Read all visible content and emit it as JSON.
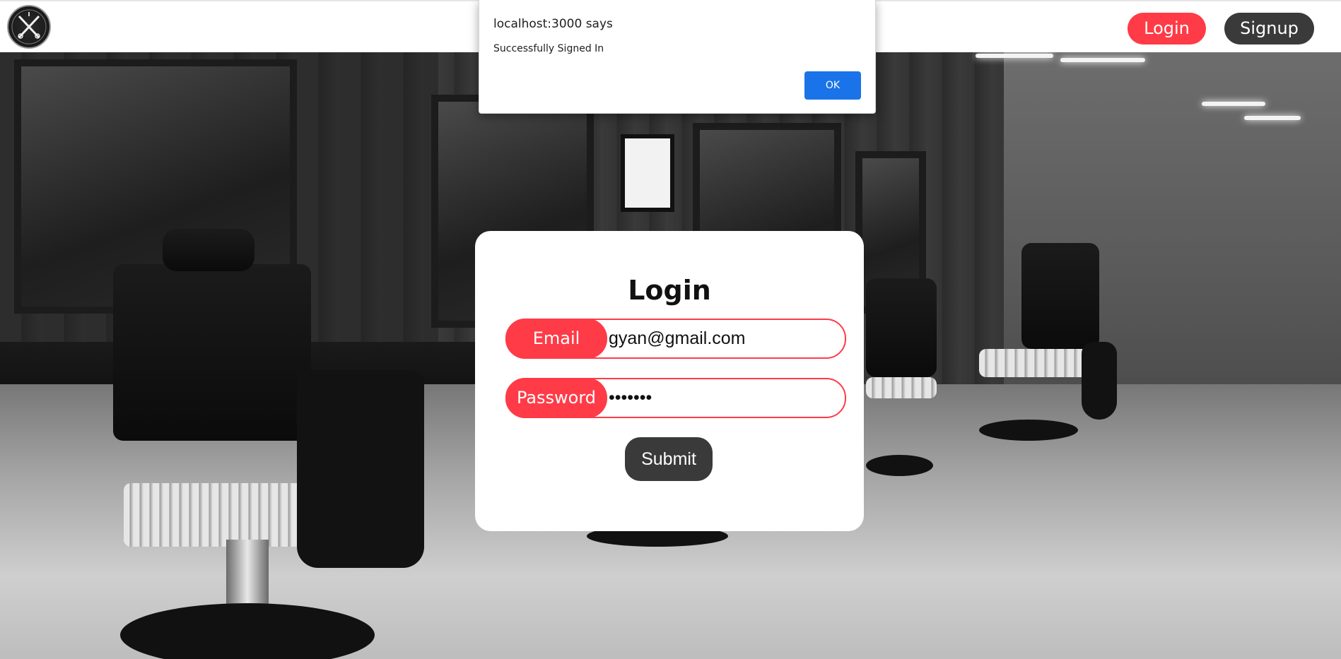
{
  "header": {
    "logo_icon": "barber-scissors-logo-icon",
    "login_label": "Login",
    "signup_label": "Signup"
  },
  "background": {
    "description_icon": "barbershop-photo"
  },
  "login_card": {
    "title": "Login",
    "email_label": "Email",
    "email_value": "gyan@gmail.com",
    "password_label": "Password",
    "password_value": "•••••••",
    "submit_label": "Submit"
  },
  "alert": {
    "title": "localhost:3000 says",
    "message": "Successfully Signed In",
    "ok_label": "OK"
  },
  "colors": {
    "accent": "#ff3b47",
    "dark": "#3a3a3a",
    "dialog_button": "#1a73e8"
  }
}
